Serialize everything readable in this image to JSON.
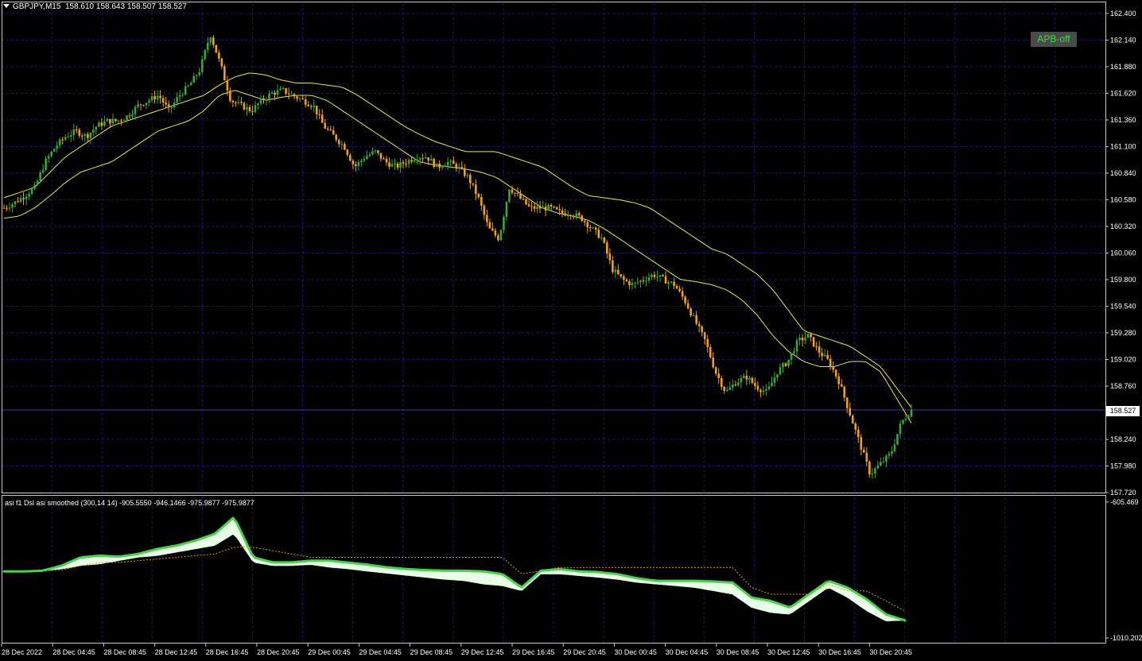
{
  "header": {
    "symbol_line": "GBPJPY,M15",
    "ohlc": "158.610 158.643 158.507 158.527"
  },
  "apb_button": {
    "label": "APB-off"
  },
  "indicator_header": {
    "text": "asi f1 Dsl asi smoothed (300,14 14) -905.5550 -946.1466 -975.9877 -975.9877"
  },
  "current_price_tag": "158.527",
  "colors": {
    "background": "#000000",
    "grid": "#1c1c64",
    "bull_candle": "#3aa53a",
    "bear_candle": "#f0a020",
    "envelope": "#e6e65a",
    "asi_up": "#4cd04c",
    "asi_down": "#ff2020",
    "fill_up": "#e8ffe8",
    "fill_down": "#ffe0b8",
    "signal_dots": "#d4a000"
  },
  "chart_data": [
    {
      "type": "candlestick",
      "title": "GBPJPY,M15",
      "ylim": [
        157.72,
        162.5
      ],
      "y_ticks": [
        "162.400",
        "162.140",
        "161.880",
        "161.620",
        "161.360",
        "161.100",
        "160.840",
        "160.580",
        "160.320",
        "160.060",
        "159.800",
        "159.540",
        "159.280",
        "159.020",
        "158.760",
        "158.527",
        "158.240",
        "157.980",
        "157.720"
      ],
      "x_ticks": [
        "28 Dec 2022",
        "28 Dec 04:45",
        "28 Dec 08:45",
        "28 Dec 12:45",
        "28 Dec 16:45",
        "28 Dec 20:45",
        "29 Dec 00:45",
        "29 Dec 04:45",
        "29 Dec 08:45",
        "29 Dec 12:45",
        "29 Dec 16:45",
        "29 Dec 20:45",
        "30 Dec 00:45",
        "30 Dec 04:45",
        "30 Dec 08:45",
        "30 Dec 12:45",
        "30 Dec 16:45",
        "30 Dec 20:45"
      ],
      "close_path": [
        160.5,
        160.55,
        160.62,
        160.7,
        160.95,
        161.1,
        161.2,
        161.25,
        161.2,
        161.3,
        161.35,
        161.35,
        161.4,
        161.5,
        161.55,
        161.6,
        161.45,
        161.6,
        161.7,
        161.85,
        162.2,
        161.9,
        161.55,
        161.5,
        161.45,
        161.55,
        161.62,
        161.65,
        161.6,
        161.55,
        161.5,
        161.3,
        161.2,
        161.1,
        160.9,
        161.0,
        161.05,
        160.95,
        160.9,
        160.95,
        161.0,
        161.0,
        160.9,
        160.95,
        160.9,
        160.8,
        160.6,
        160.3,
        160.2,
        160.7,
        160.6,
        160.5,
        160.5,
        160.5,
        160.45,
        160.45,
        160.4,
        160.3,
        160.2,
        159.9,
        159.8,
        159.75,
        159.8,
        159.85,
        159.8,
        159.75,
        159.6,
        159.4,
        159.2,
        158.9,
        158.7,
        158.8,
        158.85,
        158.75,
        158.7,
        158.9,
        159.0,
        159.2,
        159.25,
        159.1,
        159.0,
        158.8,
        158.5,
        158.2,
        157.9,
        158.0,
        158.1,
        158.4,
        158.527
      ],
      "current_price": 158.527,
      "envelope_upper_path": [
        160.6,
        160.65,
        160.7,
        160.85,
        161.0,
        161.1,
        161.2,
        161.3,
        161.35,
        161.4,
        161.45,
        161.5,
        161.55,
        161.6,
        161.7,
        161.78,
        161.82,
        161.8,
        161.75,
        161.72,
        161.72,
        161.7,
        161.68,
        161.6,
        161.5,
        161.4,
        161.3,
        161.22,
        161.15,
        161.1,
        161.05,
        161.05,
        161.05,
        161.0,
        160.95,
        160.9,
        160.8,
        160.7,
        160.62,
        160.6,
        160.58,
        160.55,
        160.5,
        160.4,
        160.3,
        160.2,
        160.1,
        160.05,
        159.95,
        159.85,
        159.7,
        159.5,
        159.3,
        159.25,
        159.2,
        159.15,
        159.05,
        158.95,
        158.75,
        158.55
      ],
      "envelope_lower_path": [
        160.4,
        160.42,
        160.5,
        160.62,
        160.75,
        160.85,
        160.9,
        160.95,
        161.05,
        161.15,
        161.25,
        161.3,
        161.35,
        161.45,
        161.6,
        161.65,
        161.6,
        161.55,
        161.58,
        161.6,
        161.6,
        161.55,
        161.45,
        161.35,
        161.25,
        161.15,
        161.05,
        160.95,
        160.92,
        160.9,
        160.88,
        160.85,
        160.8,
        160.7,
        160.6,
        160.5,
        160.45,
        160.42,
        160.38,
        160.3,
        160.2,
        160.1,
        160.0,
        159.9,
        159.8,
        159.78,
        159.75,
        159.7,
        159.6,
        159.45,
        159.25,
        159.1,
        159.0,
        158.95,
        158.95,
        159.0,
        159.0,
        158.9,
        158.65,
        158.4
      ]
    },
    {
      "type": "line",
      "title": "asi f1 Dsl asi smoothed (300,14 14)",
      "y_ticks": [
        "-605.469",
        "-1010.202"
      ],
      "ylim": [
        -1010.202,
        -605.469
      ],
      "series": [
        {
          "values": [
            -812,
            -812,
            -810,
            -795,
            -770,
            -765,
            -768,
            -760,
            -745,
            -735,
            -720,
            -700,
            -650,
            -770,
            -785,
            -785,
            -780,
            -780,
            -786,
            -792,
            -800,
            -805,
            -808,
            -810,
            -810,
            -812,
            -820,
            -860,
            -810,
            -805,
            -812,
            -814,
            -820,
            -832,
            -840,
            -840,
            -840,
            -842,
            -845,
            -890,
            -900,
            -920,
            -880,
            -840,
            -860,
            -895,
            -940,
            -958
          ]
        },
        {
          "values": [
            -812,
            -812,
            -810,
            -805,
            -795,
            -790,
            -780,
            -770,
            -765,
            -755,
            -745,
            -735,
            -700,
            -785,
            -795,
            -795,
            -792,
            -800,
            -805,
            -812,
            -818,
            -824,
            -830,
            -836,
            -840,
            -850,
            -855,
            -870,
            -820,
            -820,
            -825,
            -830,
            -836,
            -845,
            -850,
            -855,
            -860,
            -870,
            -880,
            -920,
            -935,
            -940,
            -900,
            -860,
            -890,
            -930,
            -960,
            -958
          ]
        },
        {
          "values": [
            -812,
            -812,
            -810,
            -808,
            -795,
            -785,
            -785,
            -780,
            -775,
            -770,
            -765,
            -760,
            -740,
            -740,
            -750,
            -760,
            -770,
            -770,
            -770,
            -770,
            -770,
            -770,
            -770,
            -770,
            -770,
            -770,
            -770,
            -820,
            -810,
            -800,
            -800,
            -800,
            -800,
            -800,
            -800,
            -800,
            -800,
            -800,
            -800,
            -860,
            -880,
            -880,
            -880,
            -850,
            -870,
            -870,
            -900,
            -930
          ]
        }
      ]
    }
  ]
}
